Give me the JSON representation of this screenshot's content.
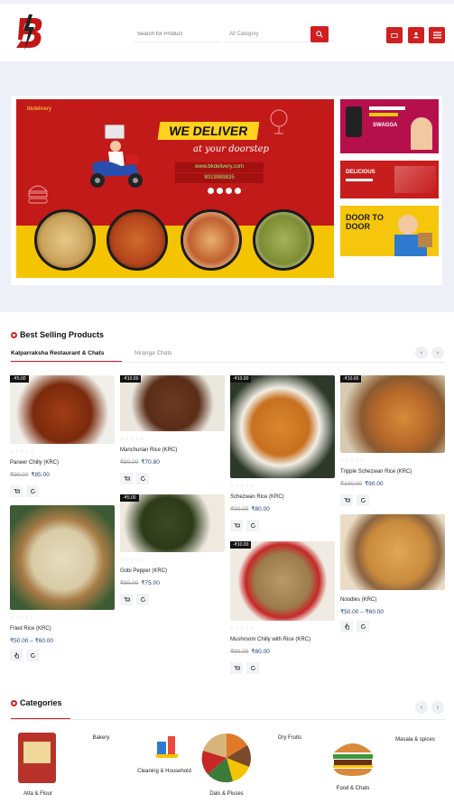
{
  "header": {
    "search_placeholder": "Search for Product",
    "category_label": "All Category"
  },
  "banner": {
    "brand": "bkdelivery",
    "headline": "WE DELIVER",
    "tagline": "at your doorstep",
    "url": "www.bkdelivery.com",
    "phone": "8019989835"
  },
  "side_banners": [
    {
      "label": "SWAGGA"
    },
    {
      "label": "DELICIOUS"
    },
    {
      "label": "DOOR TO DOOR"
    }
  ],
  "best_selling": {
    "title": "Best Selling Products",
    "tabs": [
      "Kalparraksha Restaurant & Chats",
      "Niranga Chats"
    ],
    "products": [
      {
        "tag": "-₹5.00",
        "name": "Paneer Chilly (KRC)",
        "old": "₹90.00",
        "new": "₹85.00"
      },
      {
        "tag": "-₹10.00",
        "name": "Manchurian Rice (KRC)",
        "old": "₹80.00",
        "new": "₹70.80"
      },
      {
        "tag": "-₹10.00",
        "name": "Schezwan Rice (KRC)",
        "old": "₹90.00",
        "new": "₹80.00"
      },
      {
        "tag": "-₹10.00",
        "name": "Tripple Schezwan Rice (KRC)",
        "old": "₹100.00",
        "new": "₹90.00"
      },
      {
        "tag": "",
        "name": "Fried Rice (KRC)",
        "old": "",
        "new": "₹50.00 – ₹60.00"
      },
      {
        "tag": "-₹5.00",
        "name": "Gobi Pepper (KRC)",
        "old": "₹80.00",
        "new": "₹75.00"
      },
      {
        "tag": "-₹10.00",
        "name": "Mushroom Chilly with Rice (KRC)",
        "old": "₹90.00",
        "new": "₹80.00"
      },
      {
        "tag": "",
        "name": "Noodles (KRC)",
        "old": "",
        "new": "₹50.00 – ₹60.00"
      }
    ]
  },
  "categories": {
    "title": "Categories",
    "items": [
      "Atta & Flour",
      "Bakery",
      "Cleaning & Household",
      "Dals & Pluses",
      "Dry Fruits",
      "Food & Chats",
      "Masala & spices"
    ]
  },
  "colors": {
    "accent": "#d11f1f",
    "price_blue": "#1f3f7a",
    "banner_red": "#c21919",
    "banner_yellow": "#f5c400"
  }
}
